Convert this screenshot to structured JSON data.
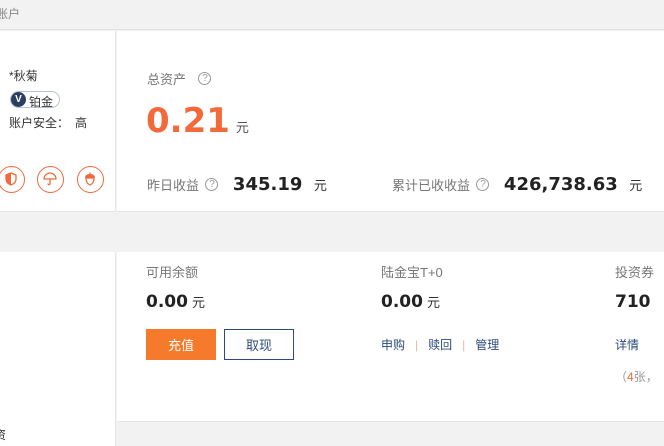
{
  "breadcrumb": "账户",
  "profile": {
    "name": "*秋菊",
    "level_badge_icon": "V",
    "level": "铂金",
    "security_label": "账户安全：",
    "security_value": "高",
    "icons": [
      "shield-icon",
      "umbrella-icon",
      "acorn-icon"
    ]
  },
  "summary": {
    "total_assets_label": "总资产",
    "total_assets_value": "0.21",
    "total_assets_unit": "元",
    "yesterday_label": "昨日收益",
    "yesterday_value": "345.19",
    "yesterday_unit": "元",
    "cumulative_label": "累计已收收益",
    "cumulative_value": "426,738.63",
    "cumulative_unit": "元"
  },
  "balances": {
    "available": {
      "label": "可用余额",
      "value": "0.00",
      "unit": "元"
    },
    "lujinbao": {
      "label": "陆金宝T+0",
      "value": "0.00",
      "unit": "元"
    },
    "coupons": {
      "label": "投资券",
      "value": "710"
    }
  },
  "actions": {
    "recharge": "充值",
    "withdraw": "取现",
    "buy": "申购",
    "redeem": "赎回",
    "manage": "管理",
    "detail": "详情",
    "sep": "|"
  },
  "coupon_count": {
    "prefix": "（",
    "count": "4",
    "suffix": "张，"
  },
  "help_glyph": "?",
  "side_lower_text": "资",
  "colors": {
    "accent": "#f2693a",
    "button_primary": "#f57a2b",
    "link": "#2c4a7a"
  }
}
